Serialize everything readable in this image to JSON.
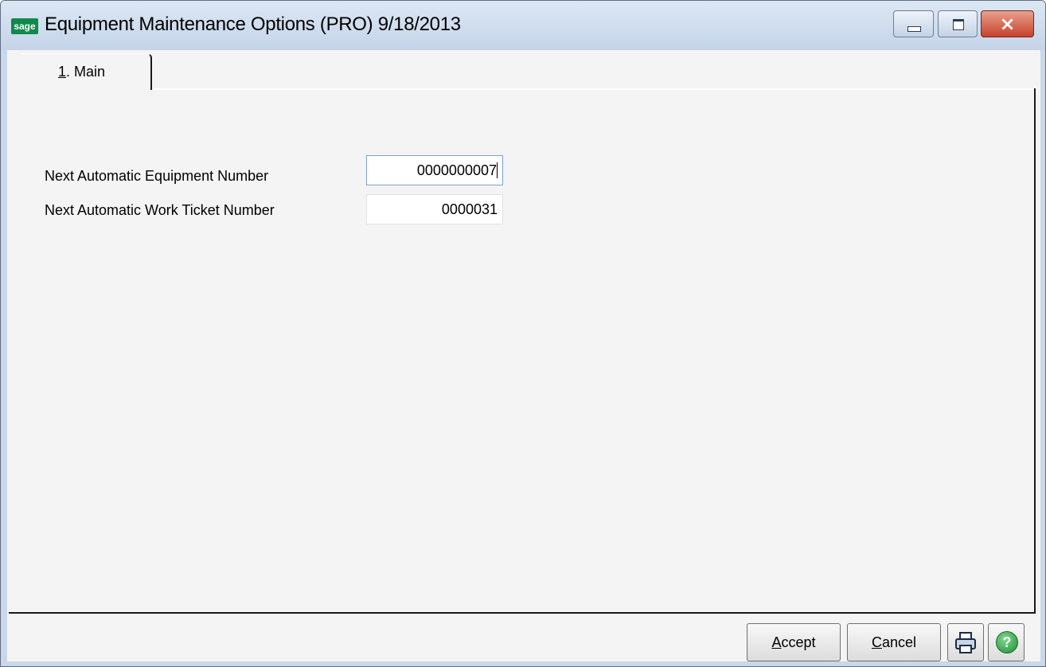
{
  "window": {
    "title": "Equipment Maintenance Options (PRO) 9/18/2013",
    "logo_text": "sage",
    "controls": {
      "minimize": "minimize-icon",
      "maximize": "maximize-icon",
      "close": "close-icon"
    }
  },
  "tabs": [
    {
      "mnemonic": "1",
      "rest": ". Main",
      "selected": true
    }
  ],
  "form": {
    "fields": [
      {
        "label": "Next Automatic Equipment Number",
        "value": "0000000007",
        "focused": true
      },
      {
        "label": "Next Automatic Work Ticket Number",
        "value": "0000031",
        "focused": false
      }
    ]
  },
  "buttons": {
    "accept": {
      "mnemonic": "A",
      "rest": "ccept"
    },
    "cancel": {
      "mnemonic": "C",
      "rest": "ancel"
    },
    "print_icon": "printer-icon",
    "help_icon": "help-icon",
    "help_glyph": "?"
  },
  "colors": {
    "title_bar": "#c9d8ea",
    "close_button": "#c7422b",
    "help_green": "#1d8e36",
    "logo_green": "#0f8a4a"
  }
}
